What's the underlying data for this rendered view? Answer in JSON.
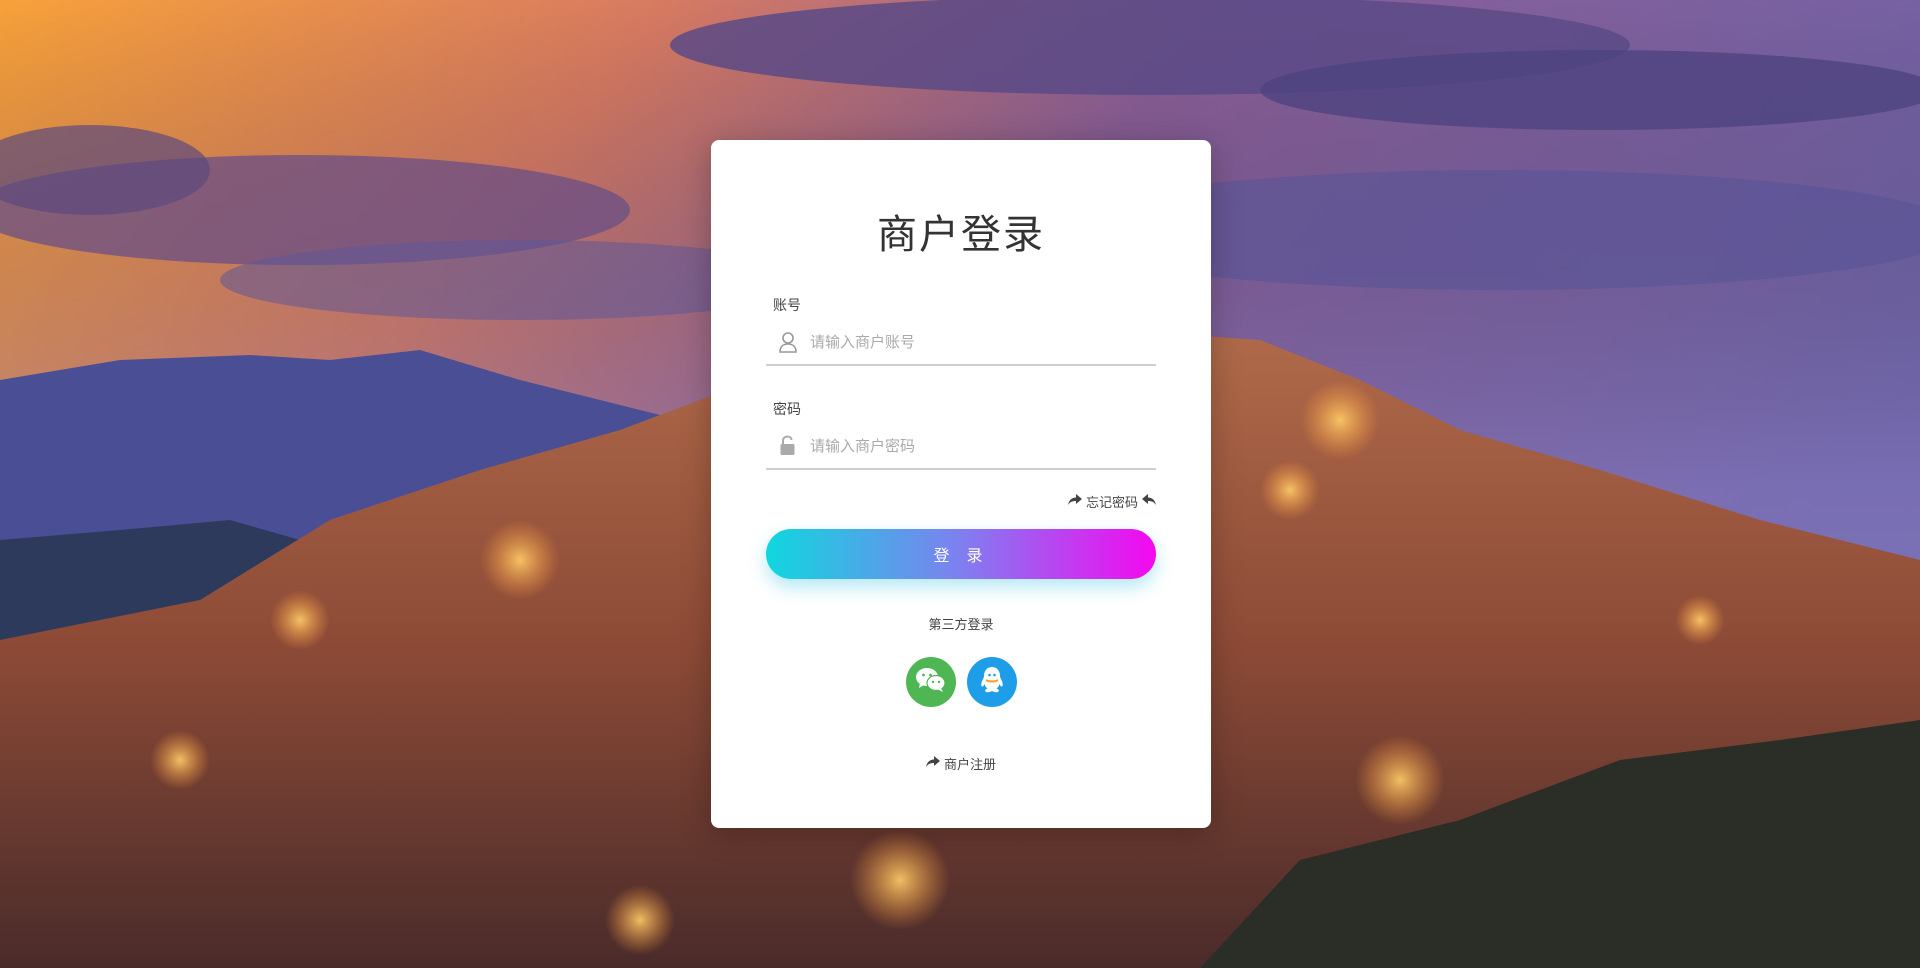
{
  "login": {
    "title": "商户登录",
    "account": {
      "label": "账号",
      "placeholder": "请输入商户账号",
      "icon": "user-icon"
    },
    "password": {
      "label": "密码",
      "placeholder": "请输入商户密码",
      "icon": "lock-icon"
    },
    "forgot_label": "忘记密码",
    "submit_label": "登 录",
    "third_party_label": "第三方登录",
    "third_party": [
      {
        "name": "wechat",
        "icon": "wechat-icon",
        "color": "#4fb654"
      },
      {
        "name": "qq",
        "icon": "qq-icon",
        "color": "#1e9de8"
      }
    ],
    "register_label": "商户注册"
  },
  "theme": {
    "gradient_start": "#10d7de",
    "gradient_end": "#f508f0"
  }
}
